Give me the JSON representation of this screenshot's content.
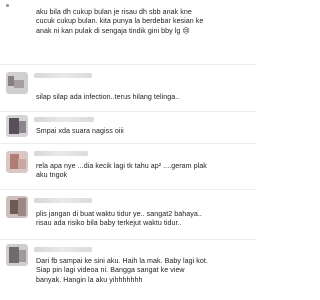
{
  "comments": [
    {
      "text": "aku bila dh cukup bulan je risau dh sbb anak kne\ncucuk cukup bulan. kita punya la berdebar kesian ke\nanak ni kan pulak di sengaja tindik gini bby lg 😢"
    },
    {
      "text": "silap silap ada infection..terus hilang telinga.."
    },
    {
      "text": "Smpai xda suara nagiss oiii"
    },
    {
      "text": "rela apa nye ...dia kecik lagi tk tahu ap² ....geram plak\naku tngok"
    },
    {
      "text": "plis jangan di buat waktu tidur ye.. sangat2 bahaya..\nrisau ada risiko bila baby terkejut waktu tidur.."
    },
    {
      "text": "Dari fb sampai ke sini aku. Haih la mak. Baby lagi kot.\nSiap pin lagi videoa ni. Bangga sangat ke view\nbanyak. Hangin la aku yihhhhhhh"
    }
  ],
  "colors": {
    "avatar_1": "#8a7f87",
    "avatar_2": "#b5b0b4",
    "avatar_3": "#585058",
    "avatar_4": "#b07d74",
    "avatar_5": "#6b5a56",
    "avatar_6": "#6e6a6e"
  }
}
